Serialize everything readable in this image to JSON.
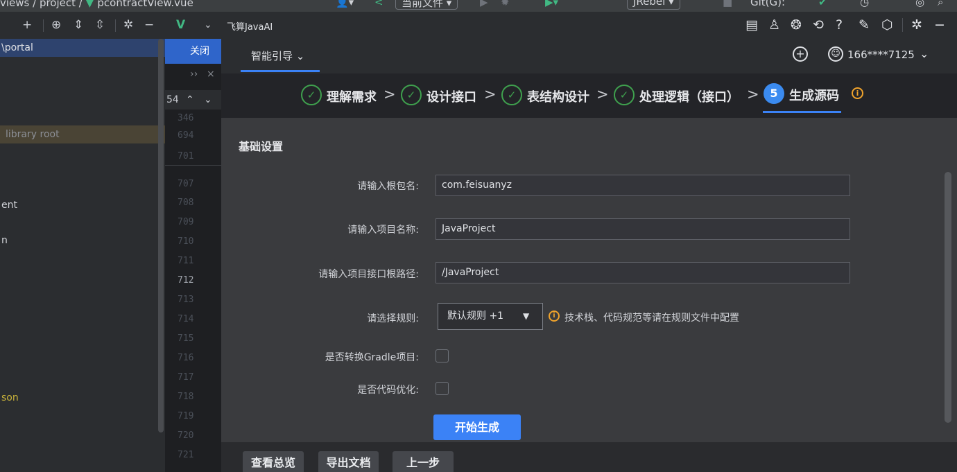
{
  "topbar": {
    "crumb_folder": "views",
    "crumb_sep": " / ",
    "crumb_project": "project",
    "crumb_file": "pcontractView.vue",
    "file_dropdown": "当前文件 ▾",
    "jrebel_dropdown": "JRebel ▾",
    "git_label": "Git(G):"
  },
  "project_tree": {
    "rows": [
      {
        "text": "\\portal"
      },
      {
        "text": "library root"
      },
      {
        "text": "ent"
      },
      {
        "text": "n"
      },
      {
        "text": "son"
      }
    ]
  },
  "editor": {
    "close_label": "关闭",
    "more_glyph": "››",
    "find_count": "54",
    "line_numbers": [
      "346",
      "694",
      "701",
      "707",
      "708",
      "709",
      "710",
      "711",
      "712",
      "713",
      "714",
      "715",
      "716",
      "717",
      "718",
      "719",
      "720",
      "721"
    ],
    "current_line": "712"
  },
  "plugin": {
    "title": "飞算JavaAI",
    "nav_tab": "智能引导 ⌄",
    "account": "166****7125",
    "steps": [
      {
        "label": "理解需求"
      },
      {
        "label": "设计接口"
      },
      {
        "label": "表结构设计"
      },
      {
        "label": "处理逻辑（接口）"
      },
      {
        "label": "生成源码",
        "number": "5"
      }
    ],
    "section_title": "基础设置",
    "form": {
      "root_package_label": "请输入根包名:",
      "root_package_value": "com.feisuanyz",
      "project_name_label": "请输入项目名称:",
      "project_name_value": "JavaProject",
      "root_path_label": "请输入项目接口根路径:",
      "root_path_value": "/JavaProject",
      "rule_label": "请选择规则:",
      "rule_value": "默认规则 +1",
      "rule_hint": "技术栈、代码规范等请在规则文件中配置",
      "gradle_label": "是否转换Gradle项目:",
      "optimize_label": "是否代码优化:"
    },
    "start_button": "开始生成",
    "bottom_buttons": {
      "overview": "查看总览",
      "export": "导出文档",
      "prev": "上一步"
    }
  },
  "colors": {
    "accent": "#3b82f6",
    "success": "#3fa14e",
    "warning": "#f0a32c"
  }
}
